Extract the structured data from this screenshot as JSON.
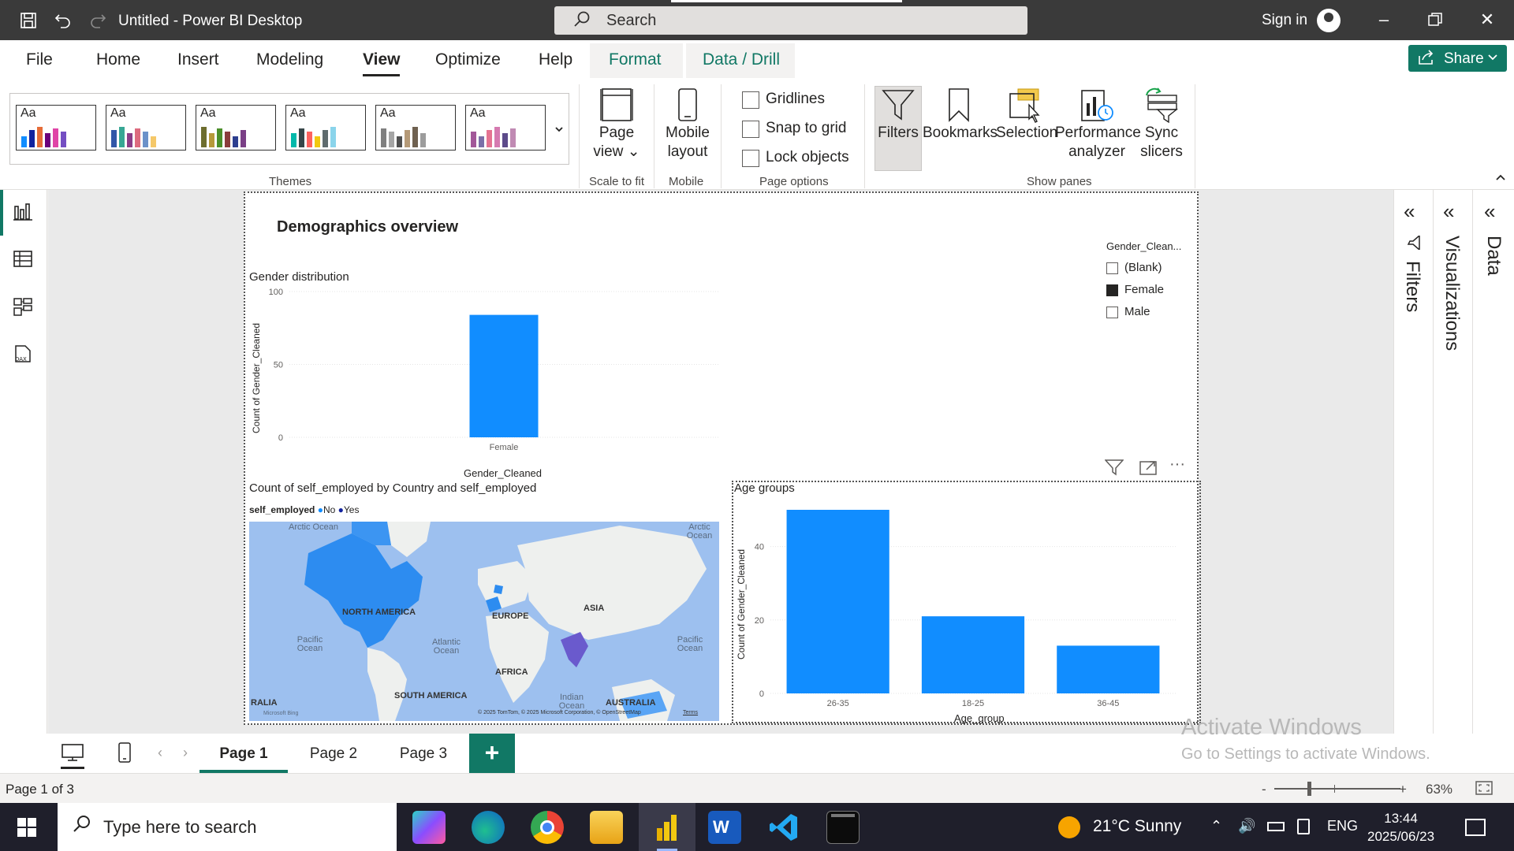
{
  "titlebar": {
    "title": "Untitled - Power BI Desktop",
    "search_placeholder": "Search",
    "signin": "Sign in"
  },
  "menu": {
    "items": [
      "File",
      "Home",
      "Insert",
      "Modeling",
      "View",
      "Optimize",
      "Help",
      "Format",
      "Data / Drill"
    ],
    "active": "View",
    "share_label": "Share"
  },
  "ribbon": {
    "themes_label": "Themes",
    "theme_tile_text": "Aa",
    "page_view": "Page view",
    "scale_to_fit": "Scale to fit",
    "mobile_layout": "Mobile layout",
    "mobile": "Mobile",
    "gridlines": "Gridlines",
    "snap_to_grid": "Snap to grid",
    "lock_objects": "Lock objects",
    "page_options": "Page options",
    "filters": "Filters",
    "bookmarks": "Bookmarks",
    "selection": "Selection",
    "performance_analyzer": "Performance analyzer",
    "sync_slicers": "Sync slicers",
    "show_panes": "Show panes"
  },
  "report": {
    "page_title": "Demographics overview",
    "gender_chart": {
      "title": "Gender distribution",
      "ylabel": "Count of Gender_Cleaned",
      "xlabel": "Gender_Cleaned"
    },
    "map": {
      "title": "Count of self_employed by Country and self_employed",
      "legend_title": "self_employed",
      "legend_items": [
        "No",
        "Yes"
      ],
      "labels": {
        "arctic1": "Arctic Ocean",
        "arctic2": "Arctic Ocean",
        "north_america": "NORTH AMERICA",
        "europe": "EUROPE",
        "asia": "ASIA",
        "pacific1": "Pacific Ocean",
        "atlantic": "Atlantic Ocean",
        "pacific2": "Pacific Ocean",
        "africa": "AFRICA",
        "south_america": "SOUTH AMERICA",
        "indian": "Indian Ocean",
        "australia": "AUSTRALIA",
        "ralia": "RALIA",
        "bing": "Microsoft Bing",
        "copyright": "© 2025 TomTom, © 2025 Microsoft Corporation, © OpenStreetMap",
        "terms": "Terms"
      }
    },
    "age_chart": {
      "title": "Age groups",
      "ylabel": "Count of Gender_Cleaned",
      "xlabel": "Age_group"
    },
    "slicer": {
      "title": "Gender_Clean...",
      "items": [
        {
          "label": "(Blank)",
          "checked": false
        },
        {
          "label": "Female",
          "checked": true
        },
        {
          "label": "Male",
          "checked": false
        }
      ]
    }
  },
  "chart_data": [
    {
      "type": "bar",
      "title": "Gender distribution",
      "xlabel": "Gender_Cleaned",
      "ylabel": "Count of Gender_Cleaned",
      "categories": [
        "Female"
      ],
      "values": [
        84
      ],
      "ylim": [
        0,
        100
      ],
      "yticks": [
        0,
        50,
        100
      ],
      "color": "#118dff"
    },
    {
      "type": "bar",
      "title": "Age groups",
      "xlabel": "Age_group",
      "ylabel": "Count of Gender_Cleaned",
      "categories": [
        "26-35",
        "18-25",
        "36-45"
      ],
      "values": [
        50,
        21,
        13
      ],
      "ylim": [
        0,
        50
      ],
      "yticks": [
        0,
        20,
        40
      ],
      "color": "#118dff"
    }
  ],
  "panes": {
    "filters": "Filters",
    "visualizations": "Visualizations",
    "data": "Data"
  },
  "pages": {
    "tabs": [
      "Page 1",
      "Page 2",
      "Page 3"
    ],
    "active": "Page 1",
    "add": "+",
    "status": "Page 1 of 3"
  },
  "watermark": {
    "line1": "Activate Windows",
    "line2": "Go to Settings to activate Windows."
  },
  "zoom": {
    "minus": "-",
    "plus": "+",
    "value": "63%"
  },
  "taskbar": {
    "search_placeholder": "Type here to search",
    "weather": "21°C  Sunny",
    "lang": "ENG",
    "time": "13:44",
    "date": "2025/06/23"
  },
  "colors": {
    "accent": "#117865",
    "bar": "#118dff",
    "map_no": "#118dff",
    "map_yes": "#12239e"
  }
}
